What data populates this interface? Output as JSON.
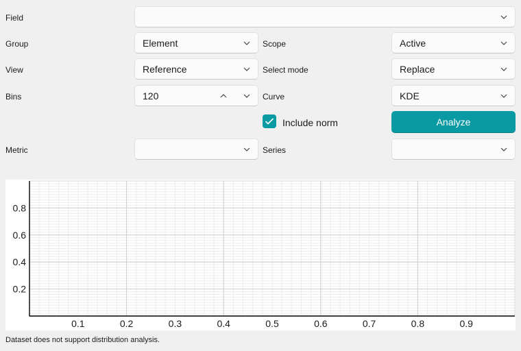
{
  "form": {
    "field": {
      "label": "Field",
      "value": ""
    },
    "group": {
      "label": "Group",
      "value": "Element"
    },
    "scope": {
      "label": "Scope",
      "value": "Active"
    },
    "view": {
      "label": "View",
      "value": "Reference"
    },
    "select_mode": {
      "label": "Select mode",
      "value": "Replace"
    },
    "bins": {
      "label": "Bins",
      "value": "120"
    },
    "curve": {
      "label": "Curve",
      "value": "KDE"
    },
    "include_norm": {
      "label": "Include norm",
      "checked": true
    },
    "analyze_label": "Analyze",
    "metric": {
      "label": "Metric",
      "value": ""
    },
    "series": {
      "label": "Series",
      "value": ""
    }
  },
  "colors": {
    "accent": "#0a9aa3"
  },
  "chart_data": {
    "type": "line",
    "series": [],
    "x_ticks": [
      "0.1",
      "0.2",
      "0.3",
      "0.4",
      "0.5",
      "0.6",
      "0.7",
      "0.8",
      "0.9"
    ],
    "y_ticks": [
      "0.2",
      "0.4",
      "0.6",
      "0.8"
    ],
    "xlim": [
      0,
      1
    ],
    "ylim": [
      0,
      1
    ],
    "grid": true,
    "minor_grid": true
  },
  "status": "Dataset does not support distribution analysis."
}
